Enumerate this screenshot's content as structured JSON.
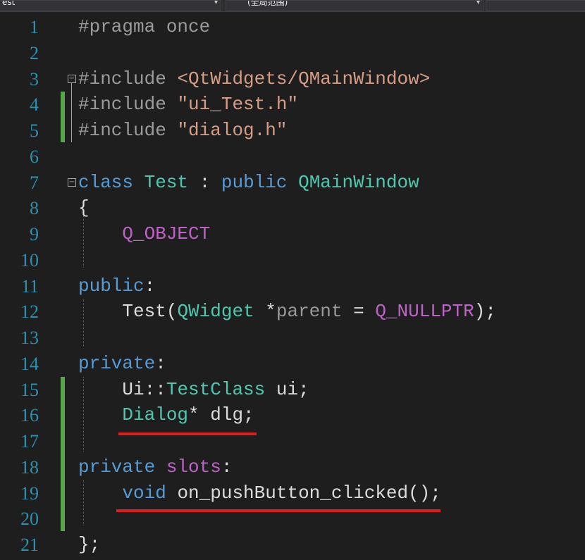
{
  "toolbar": {
    "file_dropdown": "est",
    "scope_dropdown": "(全局范围)",
    "member_dropdown": ""
  },
  "editor": {
    "lines": [
      {
        "n": "1"
      },
      {
        "n": "2"
      },
      {
        "n": "3"
      },
      {
        "n": "4"
      },
      {
        "n": "5"
      },
      {
        "n": "6"
      },
      {
        "n": "7"
      },
      {
        "n": "8"
      },
      {
        "n": "9"
      },
      {
        "n": "10"
      },
      {
        "n": "11"
      },
      {
        "n": "12"
      },
      {
        "n": "13"
      },
      {
        "n": "14"
      },
      {
        "n": "15"
      },
      {
        "n": "16"
      },
      {
        "n": "17"
      },
      {
        "n": "18"
      },
      {
        "n": "19"
      },
      {
        "n": "20"
      },
      {
        "n": "21"
      }
    ],
    "tokens": {
      "pragma": "#pragma once",
      "include1_dir": "#include ",
      "include1_arg": "<QtWidgets/QMainWindow>",
      "include2_dir": "#include ",
      "include2_arg": "\"ui_Test.h\"",
      "include3_dir": "#include ",
      "include3_arg": "\"dialog.h\"",
      "class_kw": "class",
      "class_name": "Test",
      "colon": " : ",
      "public_kw": "public",
      "base_class": "QMainWindow",
      "open_brace": "{",
      "q_object": "Q_OBJECT",
      "public_label": "public",
      "label_colon": ":",
      "ctor_name": "Test(",
      "ctor_param_type": "QWidget",
      "ctor_param_star": " *",
      "ctor_param_name": "parent",
      "ctor_eq": " = ",
      "ctor_default": "Q_NULLPTR",
      "ctor_end": ");",
      "private_label1": "private",
      "ui_ns": "Ui::",
      "ui_type": "TestClass",
      "ui_var": " ui;",
      "dlg_type": "Dialog",
      "dlg_rest": "* dlg;",
      "private_label2": "private",
      "slots_kw": "slots",
      "void_kw": "void",
      "slot_fn": " on_pushButton_clicked();",
      "close_brace": "};"
    }
  },
  "colors": {
    "background": "#1e1e1e",
    "line_number": "#2b91af",
    "keyword": "#569cd6",
    "type": "#4ec9b0",
    "macro": "#bd63c5",
    "string": "#d69d85",
    "change_bar": "#57a64a",
    "annotation_underline": "#e01e1e"
  }
}
